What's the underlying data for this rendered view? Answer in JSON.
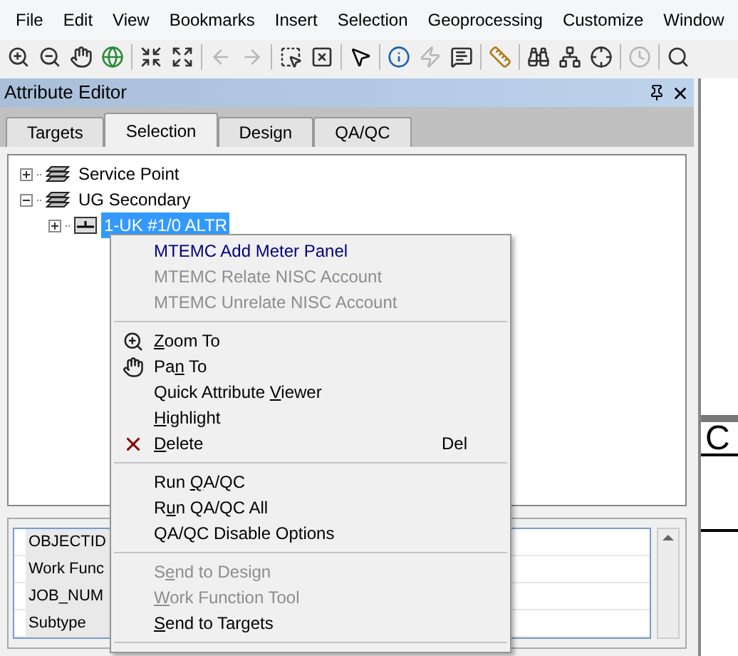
{
  "menu_bar": [
    "File",
    "Edit",
    "View",
    "Bookmarks",
    "Insert",
    "Selection",
    "Geoprocessing",
    "Customize",
    "Window"
  ],
  "toolbar": [
    {
      "kind": "zoom-in",
      "disabled": false
    },
    {
      "kind": "zoom-out",
      "disabled": false
    },
    {
      "kind": "pan",
      "disabled": false
    },
    {
      "kind": "full-extent",
      "disabled": false
    },
    {
      "kind": "sep"
    },
    {
      "kind": "fixed-in",
      "disabled": false
    },
    {
      "kind": "fixed-out",
      "disabled": false
    },
    {
      "kind": "sep"
    },
    {
      "kind": "back",
      "disabled": true
    },
    {
      "kind": "forward",
      "disabled": true
    },
    {
      "kind": "sep"
    },
    {
      "kind": "select",
      "disabled": false
    },
    {
      "kind": "clear",
      "disabled": false
    },
    {
      "kind": "sep"
    },
    {
      "kind": "pointer",
      "disabled": false
    },
    {
      "kind": "sep"
    },
    {
      "kind": "identify",
      "disabled": false
    },
    {
      "kind": "lightning",
      "disabled": true
    },
    {
      "kind": "popup",
      "disabled": false
    },
    {
      "kind": "sep"
    },
    {
      "kind": "measure",
      "disabled": false
    },
    {
      "kind": "sep"
    },
    {
      "kind": "find",
      "disabled": false
    },
    {
      "kind": "network",
      "disabled": false
    },
    {
      "kind": "goto-xy",
      "disabled": false
    },
    {
      "kind": "sep"
    },
    {
      "kind": "time",
      "disabled": true
    },
    {
      "kind": "sep"
    },
    {
      "kind": "magnifier",
      "disabled": false
    }
  ],
  "panel": {
    "title": "Attribute Editor",
    "tabs": [
      {
        "label": "Targets",
        "selected": false
      },
      {
        "label": "Selection",
        "selected": true
      },
      {
        "label": "Design",
        "selected": false
      },
      {
        "label": "QA/QC",
        "selected": false
      }
    ],
    "tree": [
      {
        "label": "Service Point",
        "expanded": false,
        "selected": false,
        "kind": "layer"
      },
      {
        "label": "UG Secondary",
        "expanded": true,
        "selected": false,
        "kind": "layer",
        "children": [
          {
            "label": "1-UK #1/0 ALTR",
            "expanded": false,
            "selected": true,
            "kind": "feature"
          }
        ]
      }
    ],
    "attributes": [
      "OBJECTID",
      "Work Func",
      "JOB_NUM",
      "Subtype"
    ]
  },
  "context_menu": [
    {
      "kind": "item",
      "before": "MTEMC Add Meter Panel",
      "disabled": false,
      "highlight": true
    },
    {
      "kind": "item",
      "before": "MTEMC Relate NISC Account",
      "disabled": true,
      "highlight": false
    },
    {
      "kind": "item",
      "before": "MTEMC Unrelate NISC Account",
      "disabled": true,
      "highlight": false
    },
    {
      "kind": "sep"
    },
    {
      "kind": "zoom-item",
      "key": "Z",
      "after": "oom To",
      "disabled": false,
      "highlight": false
    },
    {
      "kind": "pan-item",
      "before": "Pa",
      "key": "n",
      "after": " To",
      "disabled": false,
      "highlight": false
    },
    {
      "kind": "item",
      "before": "Quick Attribute ",
      "key": "V",
      "after": "iewer",
      "disabled": false,
      "highlight": false
    },
    {
      "kind": "item",
      "key": "H",
      "after": "ighlight",
      "disabled": false,
      "highlight": false
    },
    {
      "kind": "delete-item",
      "key": "D",
      "after": "elete",
      "shortcut": "Del",
      "disabled": false,
      "highlight": false
    },
    {
      "kind": "sep"
    },
    {
      "kind": "item",
      "before": "Run ",
      "key": "Q",
      "after": "A/QC",
      "disabled": false,
      "highlight": false
    },
    {
      "kind": "item",
      "before": "R",
      "key": "u",
      "after": "n QA/QC All",
      "disabled": false,
      "highlight": false
    },
    {
      "kind": "item",
      "before": "QA/QC Disable Options",
      "disabled": false,
      "highlight": false
    },
    {
      "kind": "sep"
    },
    {
      "kind": "item",
      "before": "S",
      "key": "e",
      "after": "nd to Design",
      "disabled": true,
      "highlight": false
    },
    {
      "kind": "item",
      "key": "W",
      "after": "ork Function Tool",
      "disabled": true,
      "highlight": false
    },
    {
      "kind": "item",
      "key": "S",
      "after": "end to Targets",
      "disabled": false,
      "highlight": false
    },
    {
      "kind": "sep"
    }
  ],
  "map": {
    "label": "C"
  }
}
